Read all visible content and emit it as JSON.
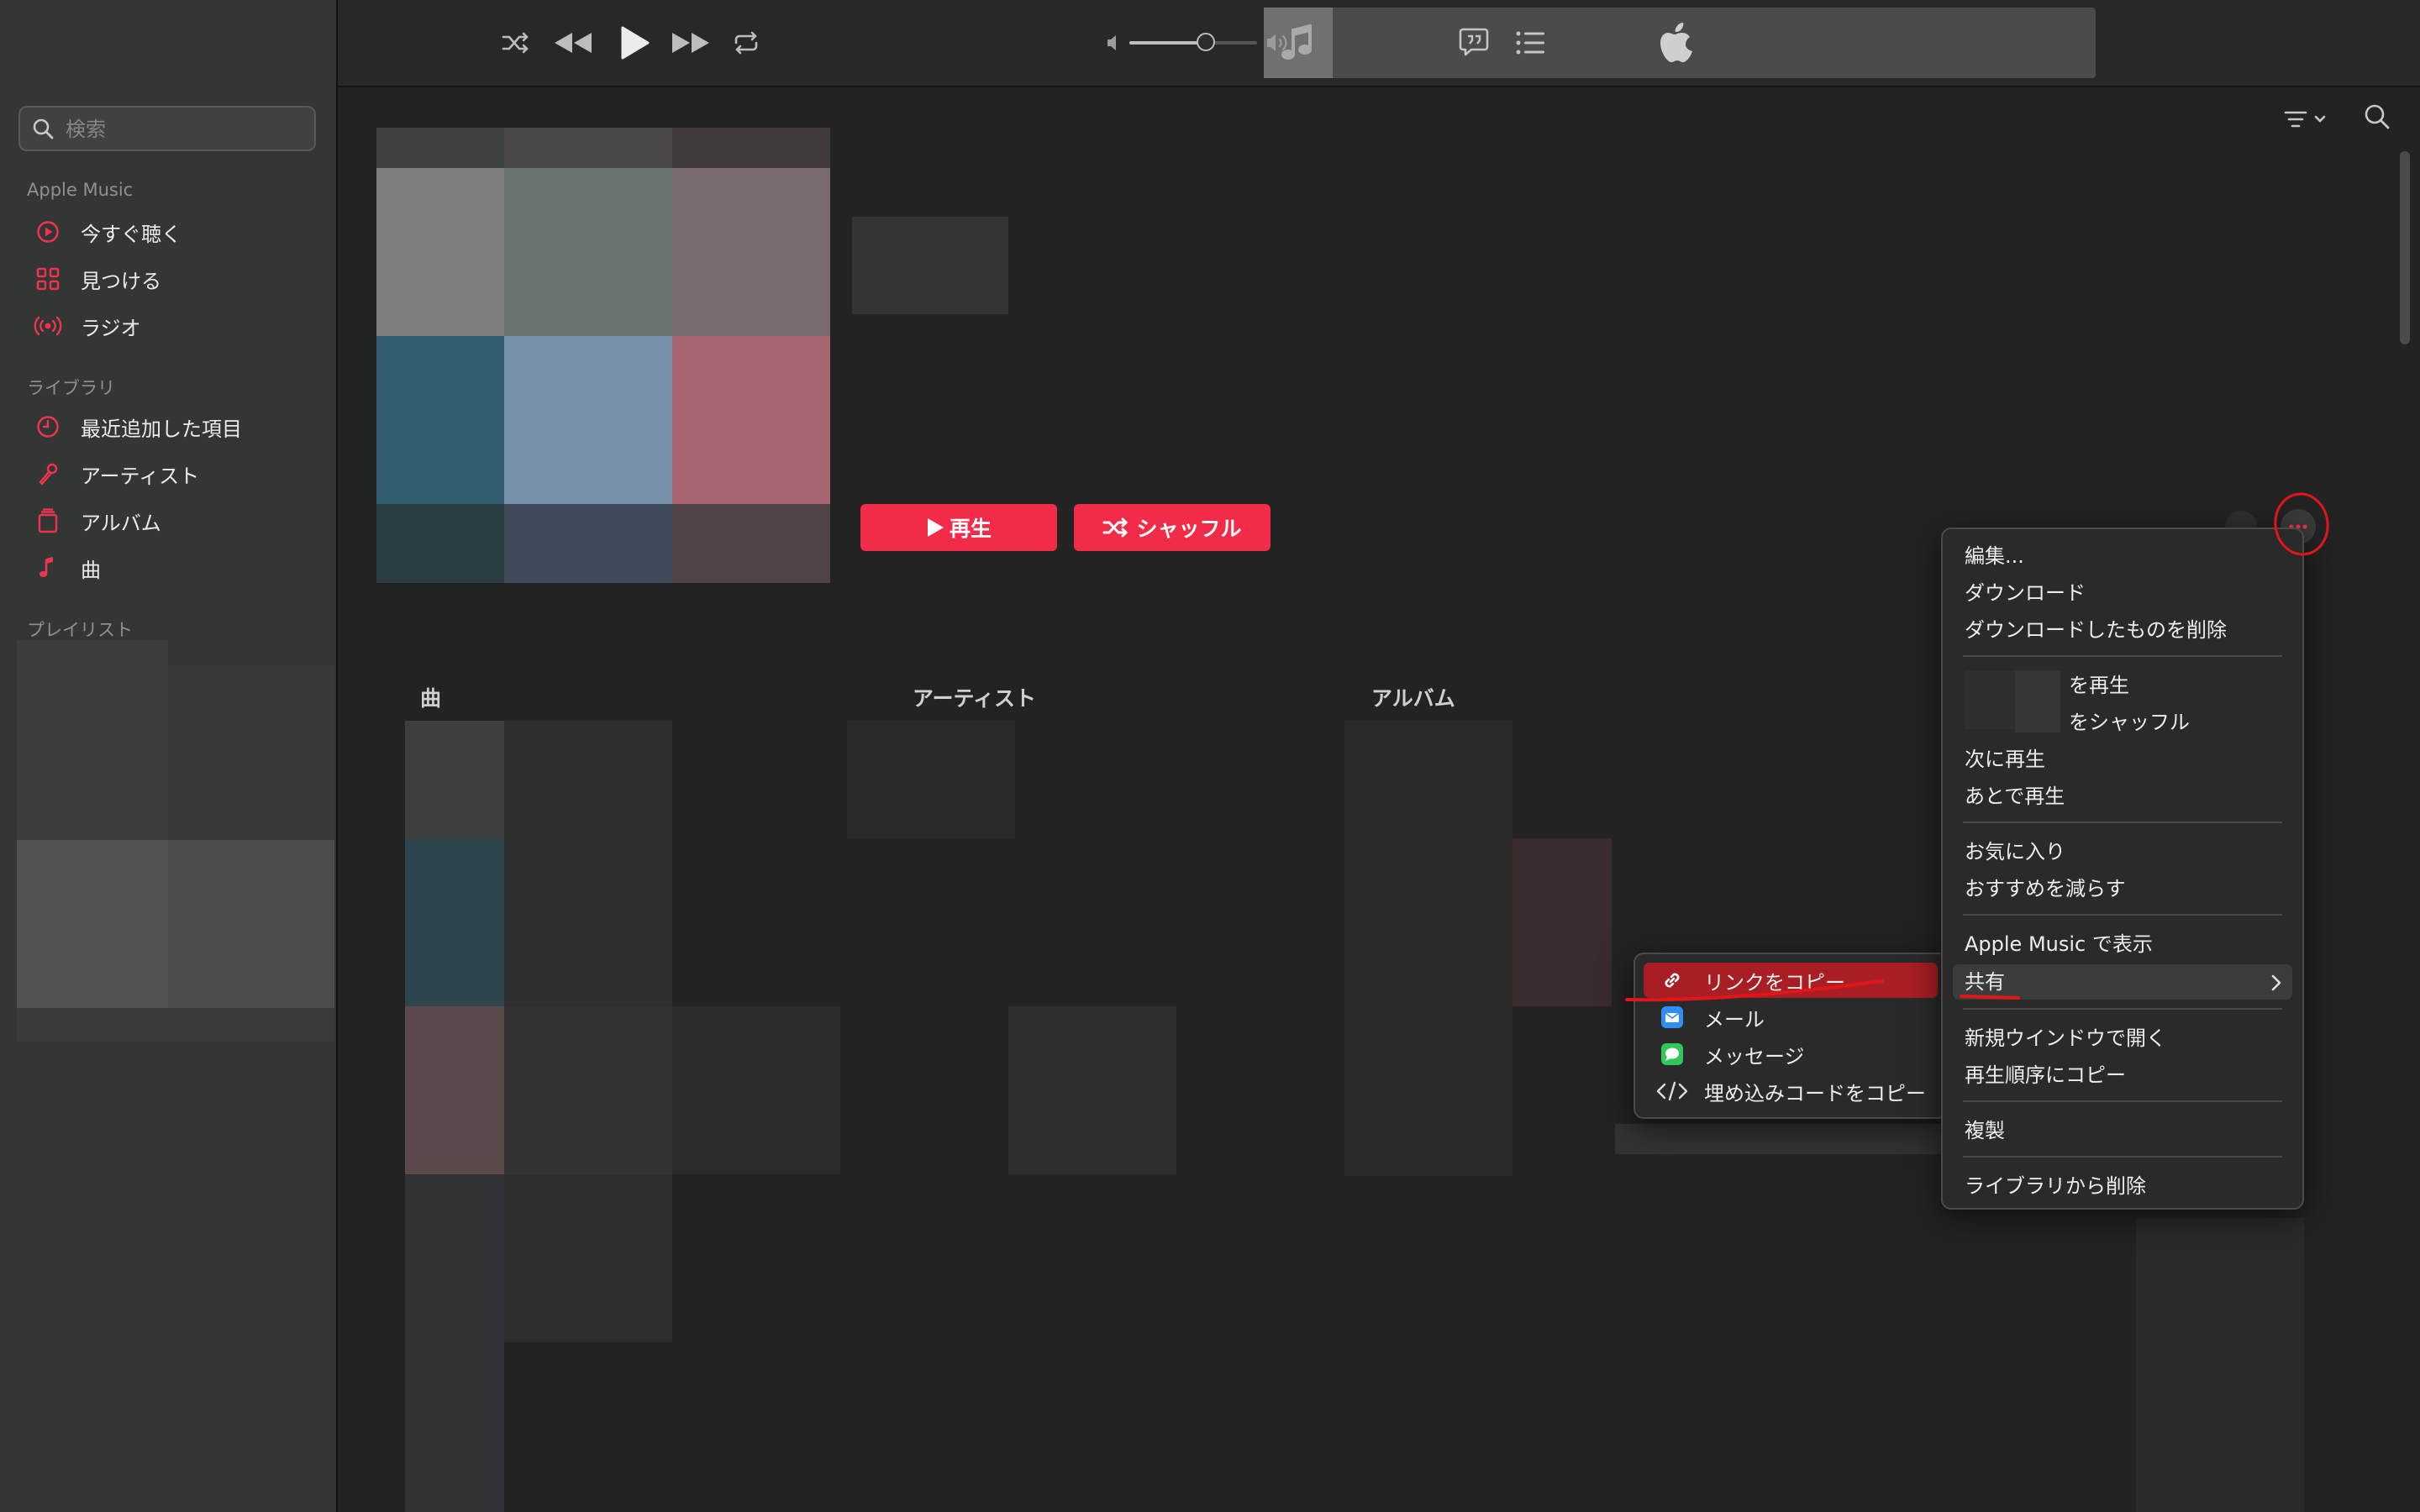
{
  "sidebar": {
    "search_placeholder": "検索",
    "sections": [
      {
        "title": "Apple Music",
        "items": [
          {
            "label": "今すぐ聴く",
            "icon": "play-circle-icon"
          },
          {
            "label": "見つける",
            "icon": "grid-icon"
          },
          {
            "label": "ラジオ",
            "icon": "radio-icon"
          }
        ]
      },
      {
        "title": "ライブラリ",
        "items": [
          {
            "label": "最近追加した項目",
            "icon": "clock-icon"
          },
          {
            "label": "アーティスト",
            "icon": "microphone-icon"
          },
          {
            "label": "アルバム",
            "icon": "album-icon"
          },
          {
            "label": "曲",
            "icon": "music-note-icon"
          }
        ]
      },
      {
        "title": "プレイリスト",
        "items": []
      }
    ]
  },
  "toolbar": {
    "icons": [
      "shuffle-icon",
      "previous-icon",
      "play-icon",
      "next-icon",
      "repeat-icon",
      "apple-logo",
      "volume-slider",
      "lyrics-icon",
      "queue-icon"
    ],
    "volume_level": 0.6
  },
  "content": {
    "play_label": "再生",
    "shuffle_label": "シャッフル",
    "columns": [
      "曲",
      "アーティスト",
      "アルバム"
    ]
  },
  "context_menu": {
    "groups": [
      [
        "編集...",
        "ダウンロード",
        "ダウンロードしたものを削除"
      ],
      [
        "を再生",
        "をシャッフル",
        "次に再生",
        "あとで再生"
      ],
      [
        "お気に入り",
        "おすすめを減らす"
      ],
      [
        "Apple Music で表示",
        "共有"
      ],
      [
        "新規ウインドウで開く",
        "再生順序にコピー"
      ],
      [
        "複製"
      ],
      [
        "ライブラリから削除"
      ]
    ]
  },
  "share_submenu": {
    "items": [
      {
        "label": "リンクをコピー",
        "icon": "link-icon",
        "highlighted": true
      },
      {
        "label": "メール",
        "icon": "mail-icon"
      },
      {
        "label": "メッセージ",
        "icon": "messages-icon"
      },
      {
        "label": "埋め込みコードをコピー",
        "icon": "embed-code-icon"
      }
    ]
  },
  "colors": {
    "accent_red": "#f12b48",
    "menu_highlight": "#a81e24",
    "annotation_red": "#e0161b"
  }
}
